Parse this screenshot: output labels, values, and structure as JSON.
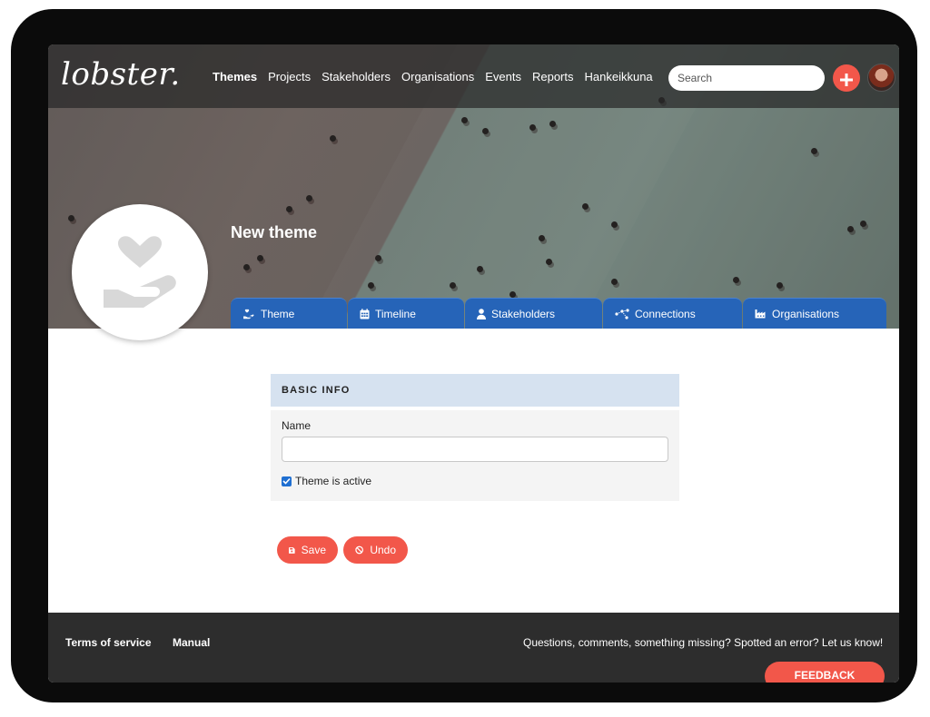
{
  "app": {
    "logo_text": "lobster."
  },
  "nav": {
    "items": [
      {
        "label": "Themes",
        "active": true
      },
      {
        "label": "Projects"
      },
      {
        "label": "Stakeholders"
      },
      {
        "label": "Organisations"
      },
      {
        "label": "Events"
      },
      {
        "label": "Reports"
      },
      {
        "label": "Hankeikkuna"
      }
    ],
    "search_placeholder": "Search",
    "add_icon": "plus-icon",
    "avatar": "user-avatar"
  },
  "hero": {
    "title": "New theme",
    "profile_icon": "heart-hand-icon"
  },
  "tabs": [
    {
      "label": "Theme",
      "icon": "hand-heart-icon"
    },
    {
      "label": "Timeline",
      "icon": "calendar-icon"
    },
    {
      "label": "Stakeholders",
      "icon": "user-icon"
    },
    {
      "label": "Connections",
      "icon": "network-icon"
    },
    {
      "label": "Organisations",
      "icon": "industry-icon"
    }
  ],
  "form": {
    "section_title": "BASIC INFO",
    "name_label": "Name",
    "name_value": "",
    "active_label": "Theme is active",
    "active_checked": true
  },
  "actions": {
    "save_label": "Save",
    "undo_label": "Undo"
  },
  "footer": {
    "terms_label": "Terms of service",
    "manual_label": "Manual",
    "message": "Questions, comments, something missing? Spotted an error? Let us know!",
    "feedback_label": "FEEDBACK"
  },
  "colors": {
    "accent": "#f2574a",
    "tab_blue": "#2664b8",
    "section_header": "#d6e2f0",
    "footer_bg": "#2d2d2d"
  }
}
